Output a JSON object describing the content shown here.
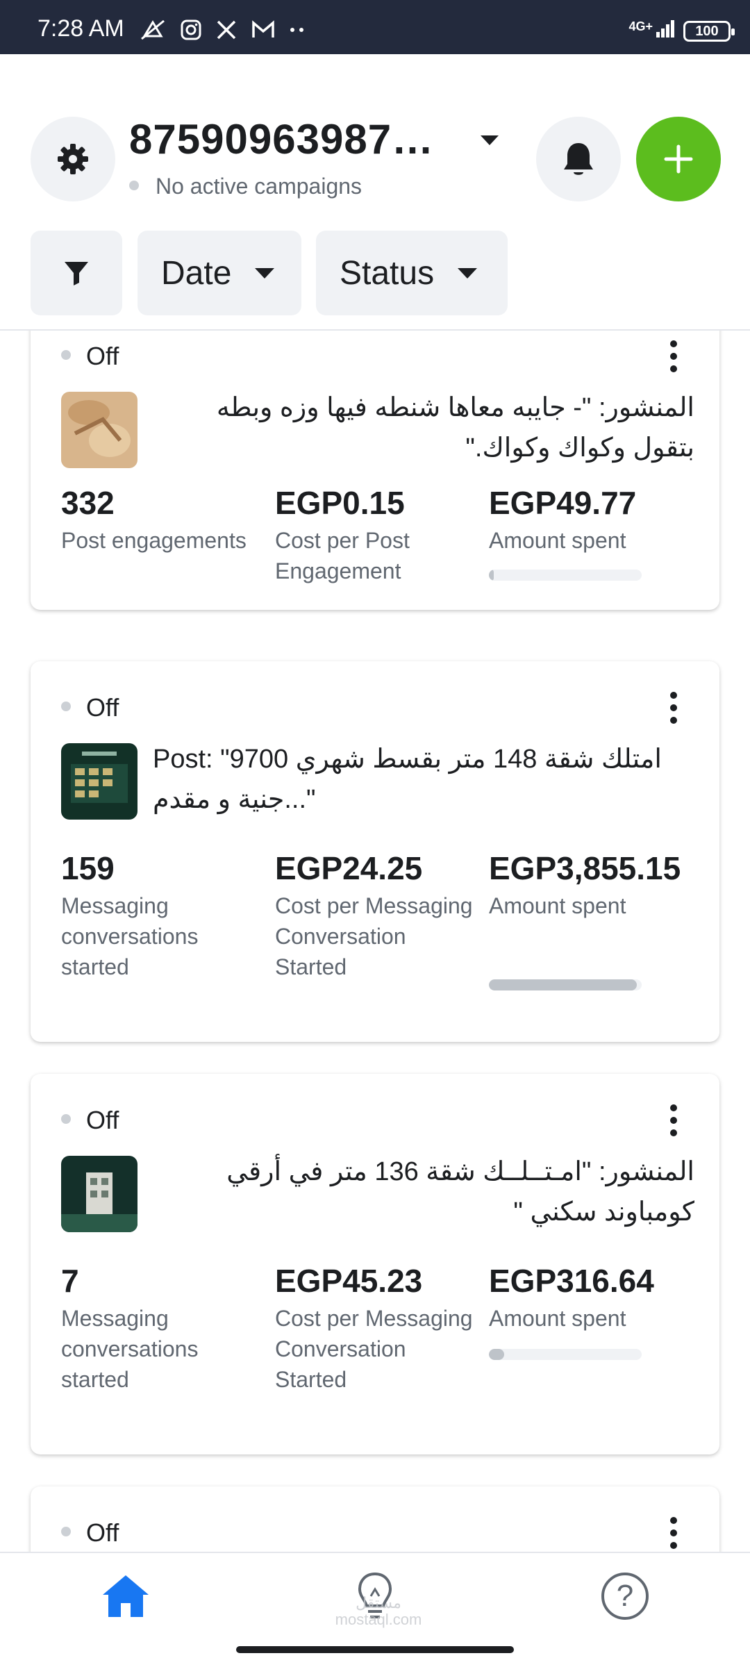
{
  "status_bar": {
    "time": "7:28 AM",
    "icons": [
      "mute-icon",
      "instagram-icon",
      "x-icon",
      "gmail-icon",
      "more-icon"
    ],
    "network": "4G+",
    "battery": "100"
  },
  "header": {
    "account_name": "87590963987…",
    "account_status": "No active campaigns"
  },
  "filters": {
    "date_label": "Date",
    "status_label": "Status"
  },
  "cards": [
    {
      "status": "Off",
      "post_text": "المنشور: \"- جايبه معاها شنطه فيها وزه وبطه بتقول وكواك وكواك.\"",
      "metrics": [
        {
          "value": "332",
          "label": "Post engagements"
        },
        {
          "value": "EGP0.15",
          "label": "Cost per Post Engagement"
        },
        {
          "value": "EGP49.77",
          "label": "Amount spent"
        }
      ],
      "spend_progress": 0.03
    },
    {
      "status": "Off",
      "post_text": "Post: \"9700 امتلك شقة 148 متر بقسط شهري جنية و مقدم...\"",
      "metrics": [
        {
          "value": "159",
          "label": "Messaging conversations started"
        },
        {
          "value": "EGP24.25",
          "label": "Cost per Messaging Conversation Started"
        },
        {
          "value": "EGP3,855.15",
          "label": "Amount spent"
        }
      ],
      "spend_progress": 0.97
    },
    {
      "status": "Off",
      "post_text": "المنشور: \"امـتــلــك شقة 136 متر في أرقي كومباوند سكني \"",
      "metrics": [
        {
          "value": "7",
          "label": "Messaging conversations started"
        },
        {
          "value": "EGP45.23",
          "label": "Cost per Messaging Conversation Started"
        },
        {
          "value": "EGP316.64",
          "label": "Amount spent"
        }
      ],
      "spend_progress": 0.1
    },
    {
      "status": "Off"
    }
  ],
  "bottom_nav": {
    "help_glyph": "?",
    "watermark": "مستقل mostaql.com"
  },
  "colors": {
    "accent_blue": "#1877f2",
    "add_green": "#5cbd1e",
    "status_bar": "#232a3d"
  }
}
